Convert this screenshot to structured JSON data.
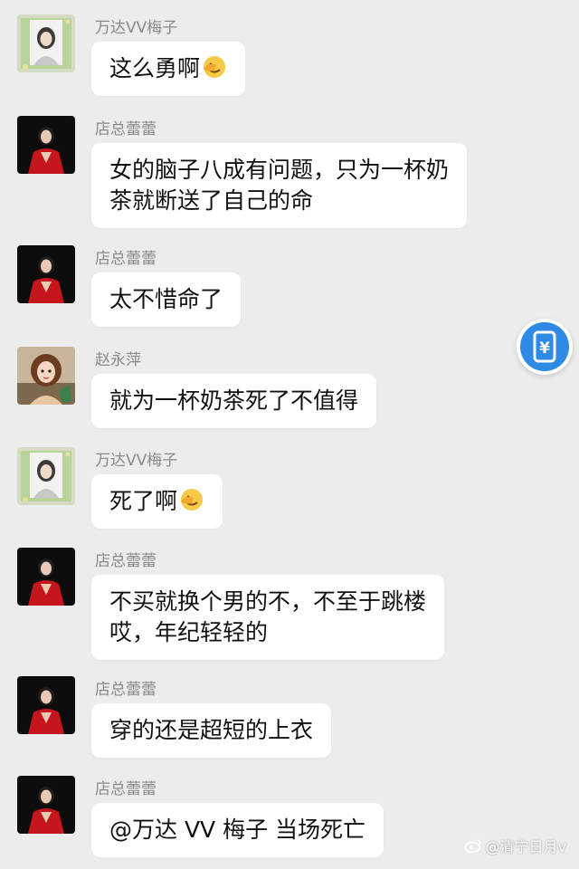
{
  "messages": [
    {
      "sender": "万达VV梅子",
      "text": "这么勇啊",
      "emoji": "facepalm-emoji",
      "avatar": "green-frame-avatar"
    },
    {
      "sender": "店总蕾蕾",
      "lines": [
        "女的脑子八成有问题，只为一杯奶",
        "茶就断送了自己的命"
      ],
      "avatar": "red-dress-avatar"
    },
    {
      "sender": "店总蕾蕾",
      "text": "太不惜命了",
      "avatar": "red-dress-avatar"
    },
    {
      "sender": "赵永萍",
      "text": "就为一杯奶茶死了不值得",
      "avatar": "girl-avatar"
    },
    {
      "sender": "万达VV梅子",
      "text": "死了啊",
      "emoji": "facepalm-emoji",
      "avatar": "green-frame-avatar"
    },
    {
      "sender": "店总蕾蕾",
      "lines": [
        "不买就换个男的不，不至于跳楼",
        "哎，年纪轻轻的"
      ],
      "avatar": "red-dress-avatar"
    },
    {
      "sender": "店总蕾蕾",
      "text": "穿的还是超短的上衣",
      "avatar": "red-dress-avatar"
    },
    {
      "sender": "店总蕾蕾",
      "text": "@万达 VV 梅子  当场死亡",
      "avatar": "red-dress-avatar"
    }
  ],
  "floating_button": {
    "icon": "yuan-payment-icon",
    "glyph": "¥"
  },
  "watermark": {
    "text": "@清宁日月v",
    "icon": "weibo-icon"
  },
  "colors": {
    "background": "#ececec",
    "bubble": "#ffffff",
    "sender": "#8a8a8a",
    "accent": "#2f8ae5"
  }
}
